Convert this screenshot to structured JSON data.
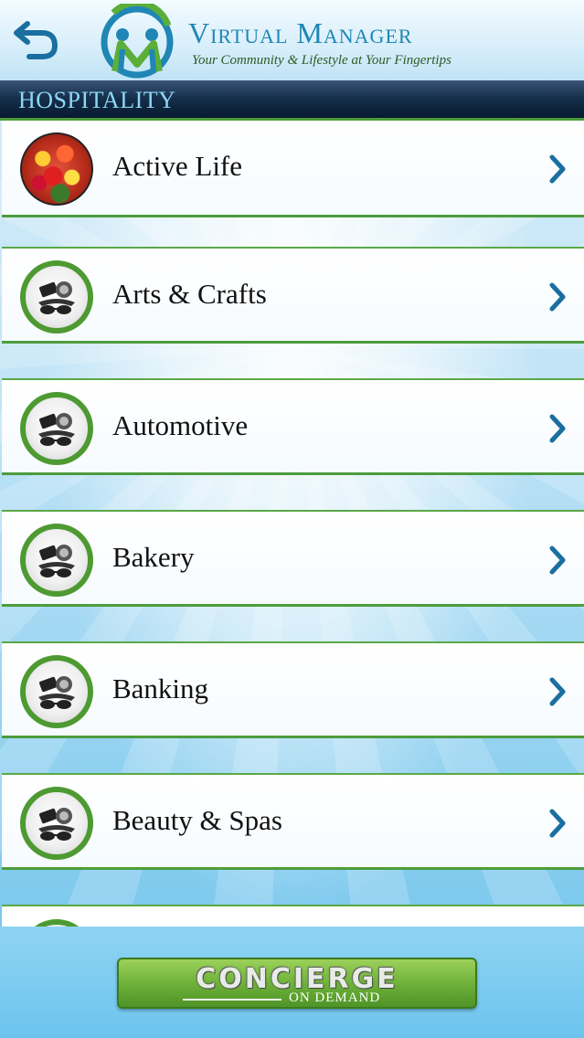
{
  "header": {
    "back_icon": "back-arrow-icon",
    "logo_icon": "vm-logo-icon",
    "title": "Virtual Manager",
    "subtitle": "Your Community & Lifestyle at Your Fingertips"
  },
  "section": {
    "title": "HOSPITALITY"
  },
  "list": {
    "items": [
      {
        "label": "Active Life",
        "icon": "flowers-photo-icon"
      },
      {
        "label": "Arts & Crafts",
        "icon": "category-tools-icon"
      },
      {
        "label": "Automotive",
        "icon": "category-tools-icon"
      },
      {
        "label": "Bakery",
        "icon": "category-tools-icon"
      },
      {
        "label": "Banking",
        "icon": "category-tools-icon"
      },
      {
        "label": "Beauty & Spas",
        "icon": "category-tools-icon"
      }
    ],
    "chevron_icon": "chevron-right-icon"
  },
  "footer": {
    "button_main": "CONCIERGE",
    "button_sub": "ON DEMAND"
  },
  "colors": {
    "accent_green": "#4e9a32",
    "accent_blue": "#1f86b5",
    "section_bar": "#0d243d"
  }
}
